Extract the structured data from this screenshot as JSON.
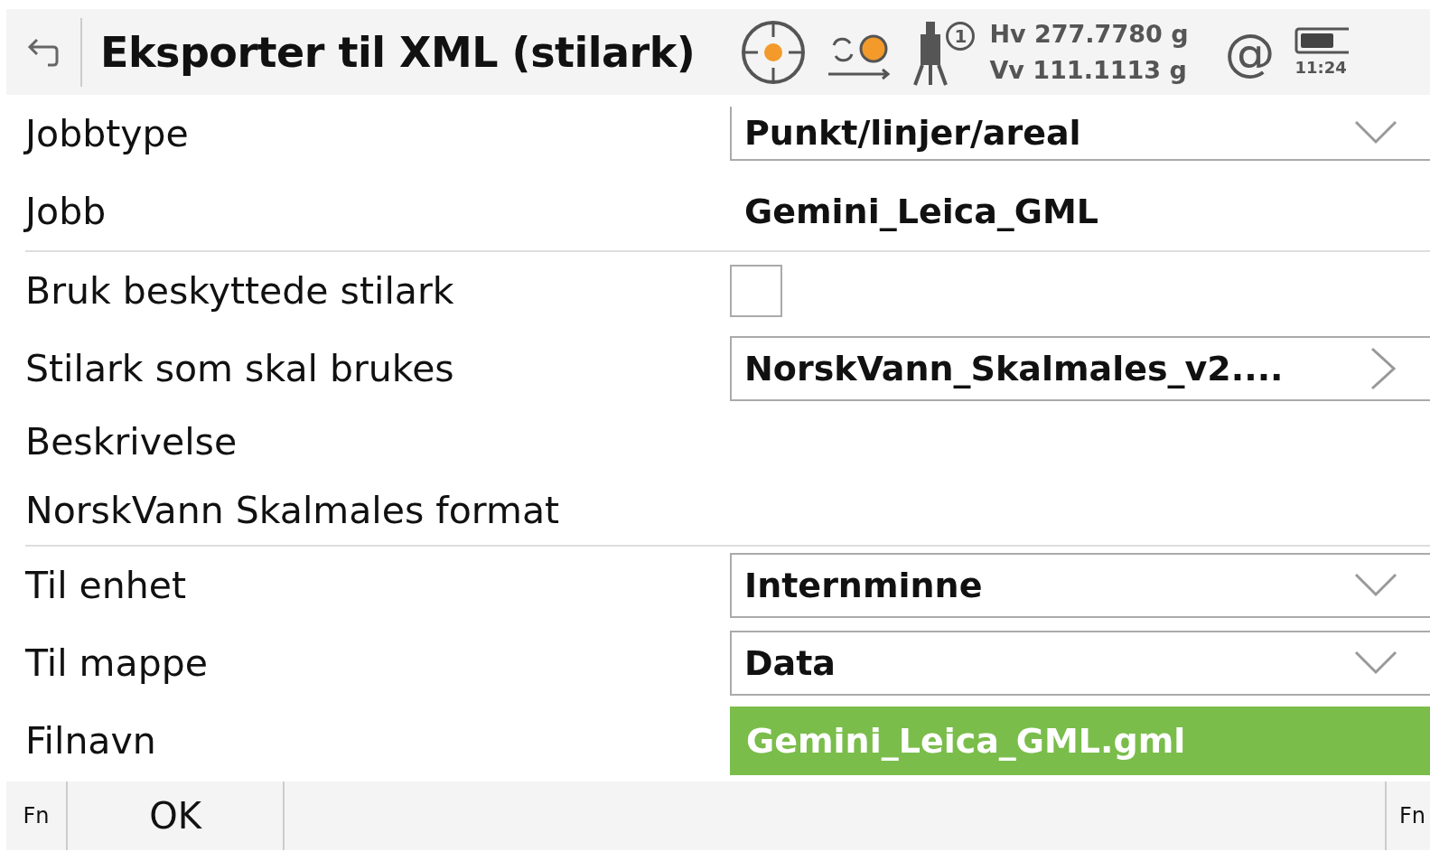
{
  "header": {
    "title": "Eksporter til XML (stilark)",
    "instrument_number": "1",
    "hv": "Hv 277.7780 g",
    "vv": "Vv 111.1113 g",
    "at": "@",
    "time": "11:24"
  },
  "sections": [
    {
      "fields": [
        {
          "kind": "dropdown",
          "label": "Jobbtype",
          "value": "Punkt/linjer/areal"
        },
        {
          "kind": "text",
          "label": "Jobb",
          "value": "Gemini_Leica_GML"
        }
      ]
    },
    {
      "fields": [
        {
          "kind": "checkbox",
          "label": "Bruk beskyttede stilark",
          "checked": false
        },
        {
          "kind": "picker",
          "label": "Stilark som skal brukes",
          "value": "NorskVann_Skalmales_v2...."
        },
        {
          "kind": "heading",
          "label": "Beskrivelse"
        },
        {
          "kind": "note",
          "label": "NorskVann Skalmales format"
        }
      ]
    },
    {
      "fields": [
        {
          "kind": "dropdown",
          "label": "Til enhet",
          "value": "Internminne"
        },
        {
          "kind": "dropdown",
          "label": "Til mappe",
          "value": "Data"
        },
        {
          "kind": "input",
          "label": "Filnavn",
          "value": "Gemini_Leica_GML.gml",
          "selected": true
        }
      ]
    }
  ],
  "footer": {
    "buttons": [
      {
        "label": "Fn"
      },
      {
        "label": "OK"
      }
    ],
    "right_button": "Fn"
  }
}
